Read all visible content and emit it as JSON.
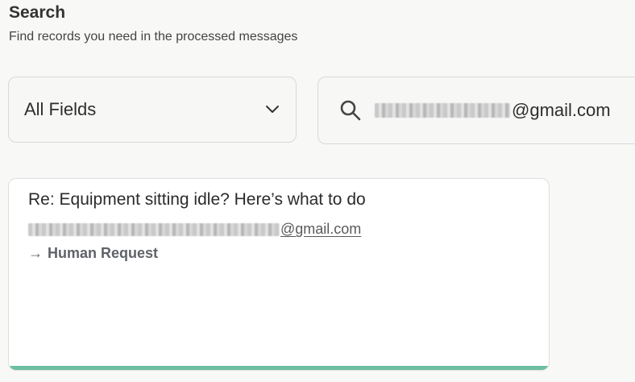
{
  "header": {
    "title": "Search",
    "subtitle": "Find records you need in the processed messages"
  },
  "filter": {
    "selected": "All Fields",
    "icon": "chevron-down-icon"
  },
  "search": {
    "icon": "search-icon",
    "value_visible_suffix": "@gmail.com"
  },
  "results": [
    {
      "subject": "Re: Equipment sitting idle? Here’s what to do",
      "sender_visible_suffix": "@gmail.com",
      "route_arrow": "→",
      "route_label": "Human Request",
      "accent_color": "#6cbea0"
    }
  ],
  "colors": {
    "background": "#f8f8f7",
    "card": "#ffffff",
    "accent": "#6cbea0",
    "border": "#d9d9d9"
  }
}
